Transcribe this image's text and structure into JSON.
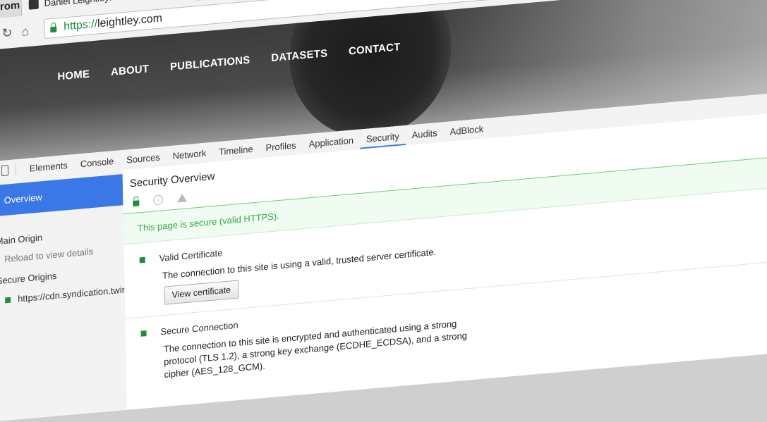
{
  "browser": {
    "app_name": "Chrom",
    "tab_title": "Daniel Leightley: Daniel Leightl",
    "tab_close": "×",
    "url_scheme": "https://",
    "url_host": "leightley.com"
  },
  "site": {
    "menu": [
      "HOME",
      "ABOUT",
      "PUBLICATIONS",
      "DATASETS",
      "CONTACT"
    ]
  },
  "devtools": {
    "tabs": [
      "Elements",
      "Console",
      "Sources",
      "Network",
      "Timeline",
      "Profiles",
      "Application",
      "Security",
      "Audits",
      "AdBlock"
    ],
    "active_tab": "Security",
    "sidebar": {
      "overview": "Overview",
      "main_origin": "Main Origin",
      "reload_hint": "Reload to view details",
      "secure_origins": "Secure Origins",
      "origin_url": "https://cdn.syndication.twimg.c"
    },
    "main": {
      "title": "Security Overview",
      "secure_message": "This page is secure (valid HTTPS).",
      "certificate_title": "Valid Certificate",
      "certificate_desc": "The connection to this site is using a valid, trusted server certificate.",
      "view_certificate": "View certificate",
      "connection_title": "Secure Connection",
      "connection_desc_1": "The connection to this site is encrypted and authenticated using a strong",
      "connection_desc_2": "protocol (TLS 1.2), a strong key exchange (ECDHE_ECDSA), and a strong",
      "connection_desc_3": "cipher (AES_128_GCM)."
    }
  },
  "colors": {
    "secure_green": "#1e8e3e",
    "secure_text_green": "#33aa44",
    "active_blue": "#3b78e7"
  }
}
